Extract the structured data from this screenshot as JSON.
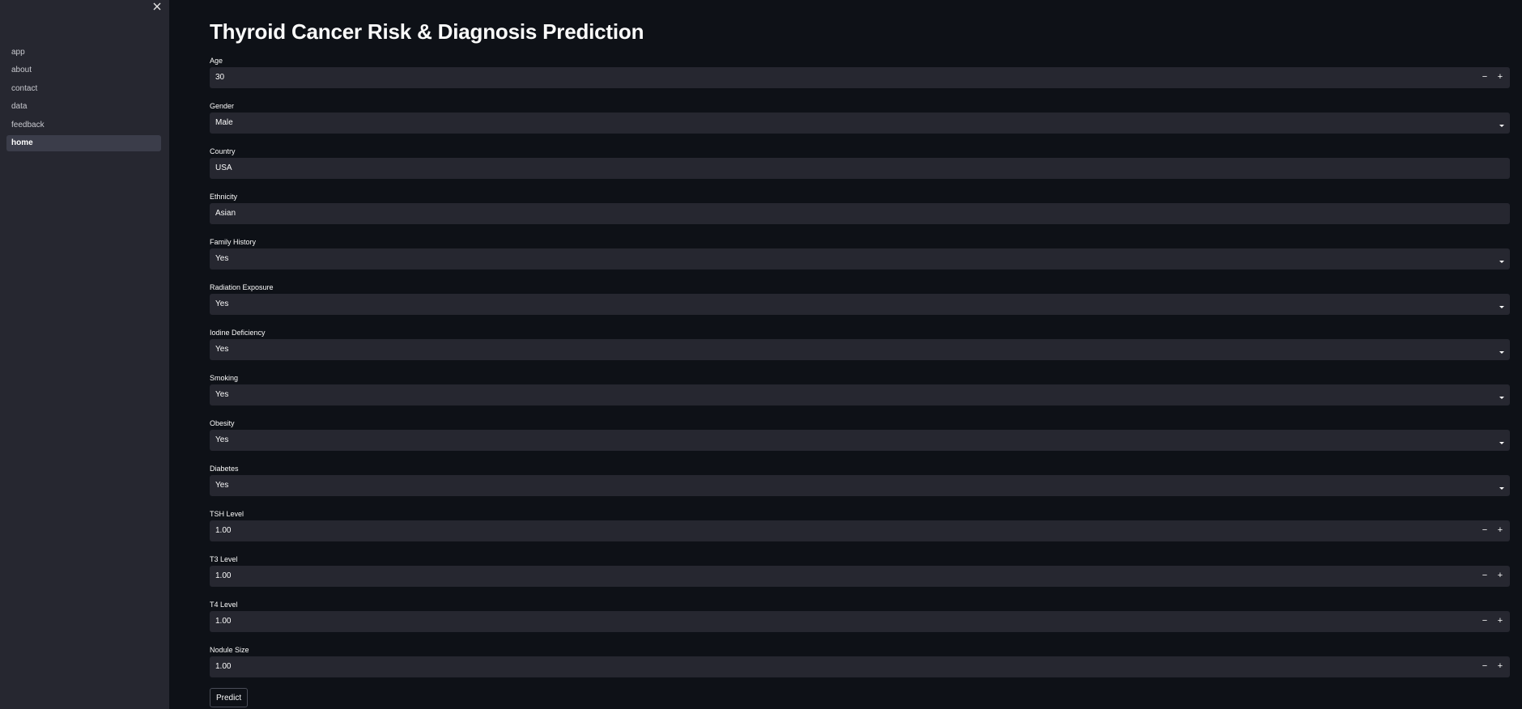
{
  "sidebar": {
    "items": [
      {
        "label": "app",
        "active": false
      },
      {
        "label": "about",
        "active": false
      },
      {
        "label": "contact",
        "active": false
      },
      {
        "label": "data",
        "active": false
      },
      {
        "label": "feedback",
        "active": false
      },
      {
        "label": "home",
        "active": true
      }
    ],
    "close_icon": "close-icon"
  },
  "main": {
    "title": "Thyroid Cancer Risk & Diagnosis Prediction",
    "fields": {
      "age": {
        "label": "Age",
        "value": "30",
        "type": "number"
      },
      "gender": {
        "label": "Gender",
        "value": "Male",
        "type": "select"
      },
      "country": {
        "label": "Country",
        "value": "USA",
        "type": "text"
      },
      "ethnicity": {
        "label": "Ethnicity",
        "value": "Asian",
        "type": "text"
      },
      "family_history": {
        "label": "Family History",
        "value": "Yes",
        "type": "select"
      },
      "radiation_exposure": {
        "label": "Radiation Exposure",
        "value": "Yes",
        "type": "select"
      },
      "iodine_deficiency": {
        "label": "Iodine Deficiency",
        "value": "Yes",
        "type": "select"
      },
      "smoking": {
        "label": "Smoking",
        "value": "Yes",
        "type": "select"
      },
      "obesity": {
        "label": "Obesity",
        "value": "Yes",
        "type": "select"
      },
      "diabetes": {
        "label": "Diabetes",
        "value": "Yes",
        "type": "select"
      },
      "tsh_level": {
        "label": "TSH Level",
        "value": "1.00",
        "type": "number"
      },
      "t3_level": {
        "label": "T3 Level",
        "value": "1.00",
        "type": "number"
      },
      "t4_level": {
        "label": "T4 Level",
        "value": "1.00",
        "type": "number"
      },
      "nodule_size": {
        "label": "Nodule Size",
        "value": "1.00",
        "type": "number"
      }
    },
    "stepper": {
      "minus": "−",
      "plus": "+"
    },
    "predict_label": "Predict"
  },
  "colors": {
    "background": "#0e1117",
    "sidebar": "#262730",
    "input": "#262730",
    "active_nav": "#3b3d4a",
    "text": "#fafafa"
  }
}
